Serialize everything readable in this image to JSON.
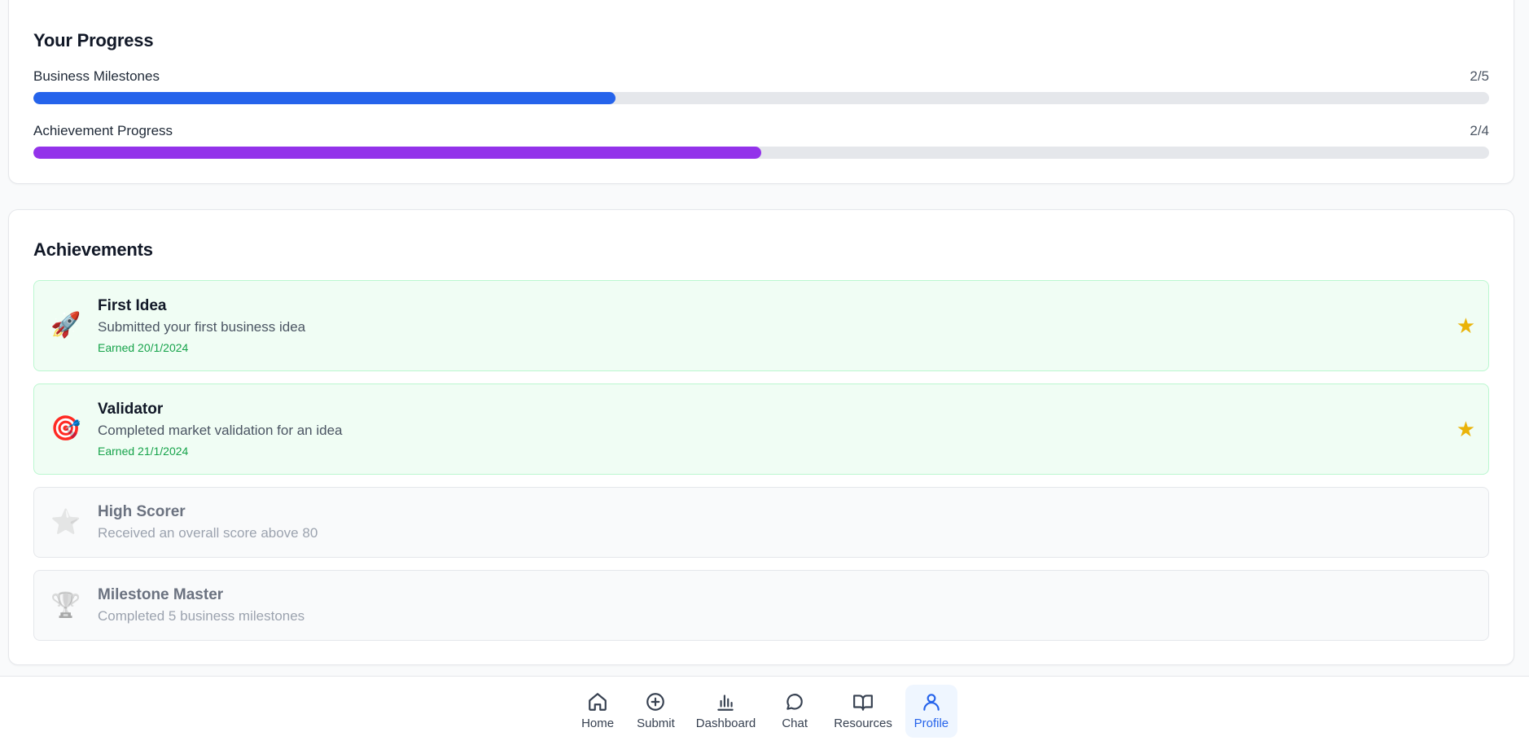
{
  "progress": {
    "title": "Your Progress",
    "bars": [
      {
        "label": "Business Milestones",
        "count": "2/5",
        "fraction": 0.4,
        "color": "#2563eb"
      },
      {
        "label": "Achievement Progress",
        "count": "2/4",
        "fraction": 0.5,
        "color": "#9333ea"
      }
    ]
  },
  "achievements": {
    "title": "Achievements",
    "items": [
      {
        "icon": "🚀",
        "icon_name": "rocket-icon",
        "title": "First Idea",
        "description": "Submitted your first business idea",
        "earned": "Earned 20/1/2024",
        "status": "earned"
      },
      {
        "icon": "🎯",
        "icon_name": "target-icon",
        "title": "Validator",
        "description": "Completed market validation for an idea",
        "earned": "Earned 21/1/2024",
        "status": "earned"
      },
      {
        "icon": "⭐",
        "icon_name": "star-icon",
        "title": "High Scorer",
        "description": "Received an overall score above 80",
        "status": "locked"
      },
      {
        "icon": "🏆",
        "icon_name": "trophy-icon",
        "title": "Milestone Master",
        "description": "Completed 5 business milestones",
        "status": "locked"
      }
    ],
    "earned_star": "★"
  },
  "nav": {
    "items": [
      {
        "label": "Home",
        "icon_name": "home-icon",
        "active": false
      },
      {
        "label": "Submit",
        "icon_name": "plus-circle-icon",
        "active": false
      },
      {
        "label": "Dashboard",
        "icon_name": "bar-chart-icon",
        "active": false
      },
      {
        "label": "Chat",
        "icon_name": "chat-bubble-icon",
        "active": false
      },
      {
        "label": "Resources",
        "icon_name": "book-open-icon",
        "active": false
      },
      {
        "label": "Profile",
        "icon_name": "user-icon",
        "active": true
      }
    ],
    "active_color": "#2563eb"
  }
}
